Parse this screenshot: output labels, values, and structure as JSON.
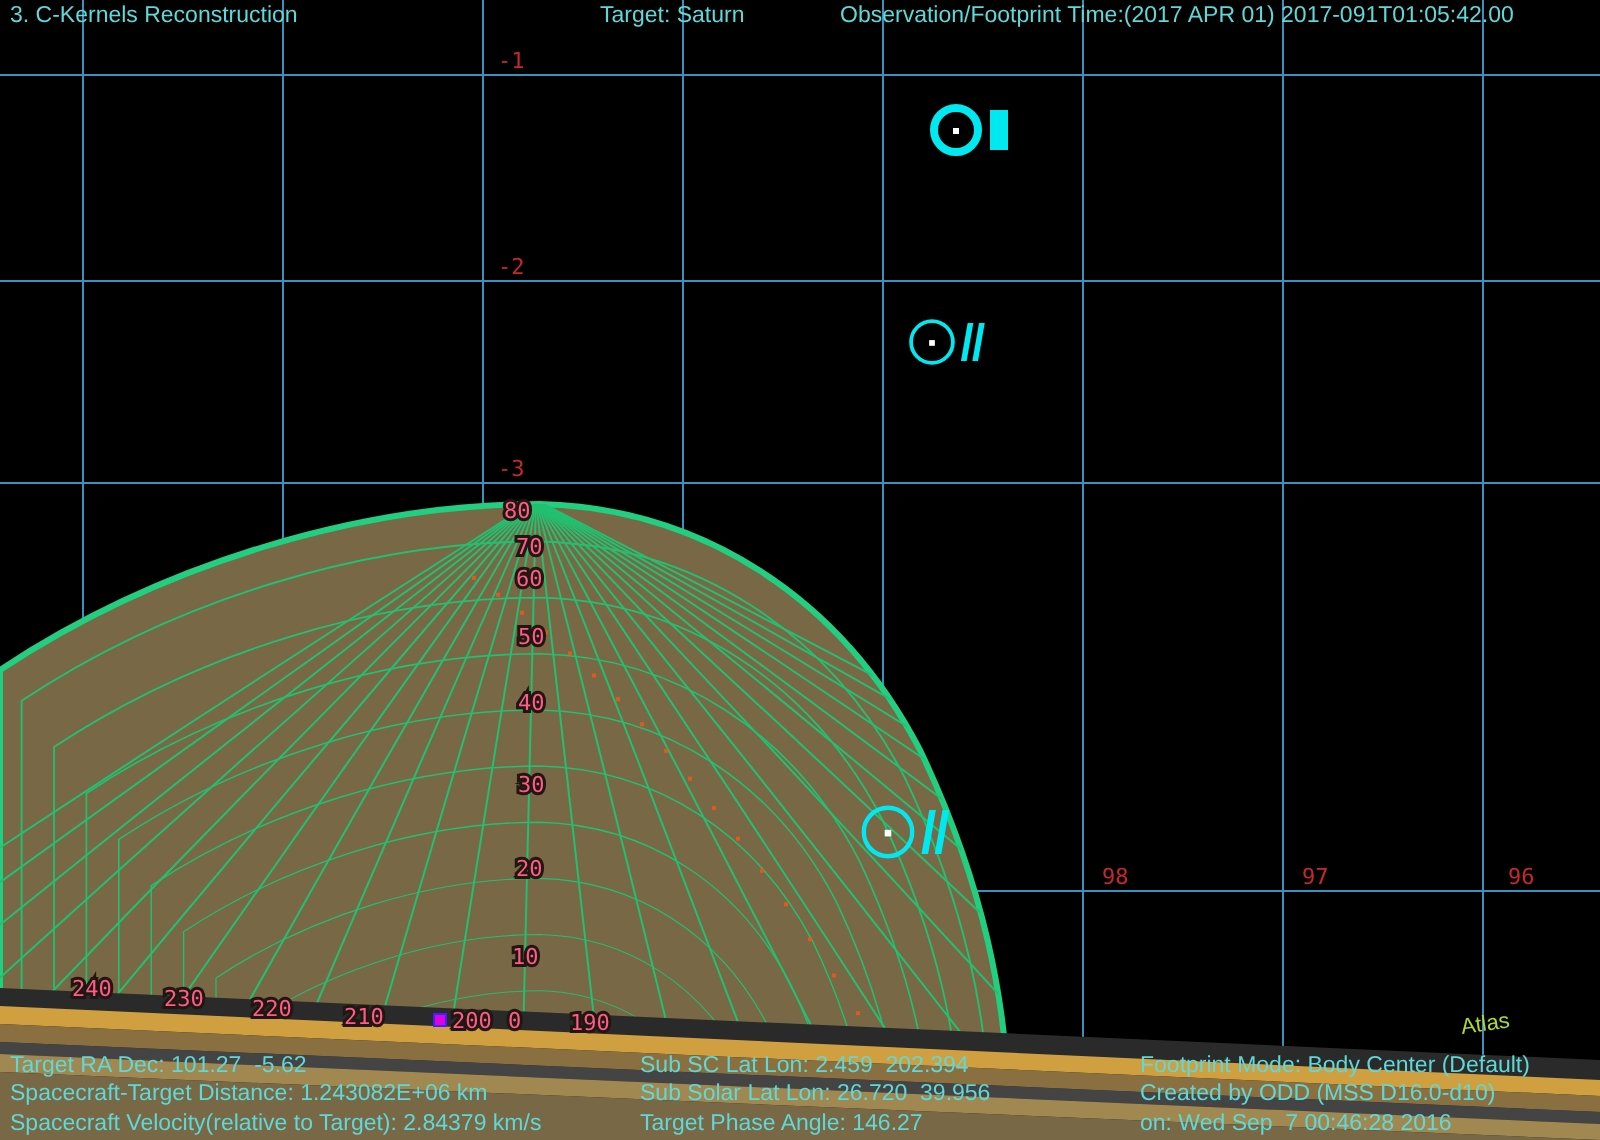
{
  "header": {
    "title": "3. C-Kernels Reconstruction",
    "target": "Target: Saturn",
    "time": "Observation/Footprint Time:(2017 APR 01) 2017-091T01:05:42.00"
  },
  "declination_labels": [
    "-1",
    "-2",
    "-3"
  ],
  "ra_labels": [
    "98",
    "97",
    "96"
  ],
  "latitude_labels": [
    "80",
    "70",
    "60",
    "50",
    "40",
    "30",
    "20",
    "10"
  ],
  "longitude_labels": [
    "240",
    "230",
    "220",
    "210",
    "200",
    "0",
    "190"
  ],
  "moon_label": "Atlas",
  "info_columns": [
    [
      "Target RA Dec: 101.27  -5.62",
      "Spacecraft-Target Distance: 1.243082E+06 km",
      "Spacecraft Velocity(relative to Target): 2.84379 km/s"
    ],
    [
      "Sub SC Lat Lon: 2.459  202.394",
      "Sub Solar Lat Lon: 26.720  39.956",
      "Target Phase Angle: 146.27"
    ],
    [
      "Footprint Mode: Body Center (Default)",
      "Created by ODD (MSS D16.0-d10)",
      "on: Wed Sep  7 00:46:28 2016"
    ]
  ]
}
